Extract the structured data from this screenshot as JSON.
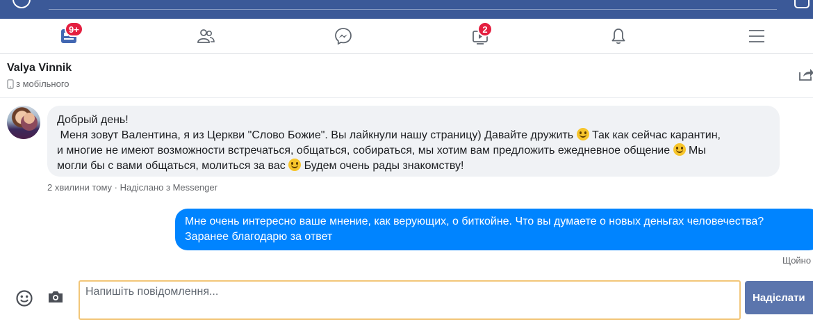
{
  "nav": {
    "items": [
      {
        "name": "news-feed",
        "badge": "9+"
      },
      {
        "name": "friends"
      },
      {
        "name": "messenger"
      },
      {
        "name": "watch",
        "badge": "2"
      },
      {
        "name": "notifications"
      },
      {
        "name": "menu"
      }
    ]
  },
  "conversation": {
    "contact_name": "Valya Vinnik",
    "contact_status": "з мобільного"
  },
  "messages": [
    {
      "direction": "incoming",
      "lines": [
        "Добрый день!",
        " Меня зовут Валентина, я из Церкви \"Слово Божие\". Вы лайкнули нашу страницу) Давайте дружить ",
        " Так как сейчас карантин,",
        "и многие не имеют возможности встречаться, общаться, собираться, мы хотим вам предложить ежедневное общение ",
        " Мы",
        "могли бы с вами общаться, молиться за вас ",
        " Будем очень рады знакомству!"
      ],
      "meta": "2 хвилини тому · Надіслано з Messenger"
    },
    {
      "direction": "outgoing",
      "lines": [
        "Мне очень интересно ваше мнение, как верующих, о биткойне. Что вы думаете о новых деньгах человечества?",
        "Заранее благодарю за ответ"
      ],
      "status": "Щойно"
    }
  ],
  "composer": {
    "placeholder": "Напишіть повідомлення...",
    "value": "",
    "send_label": "Надіслати"
  },
  "colors": {
    "topbar": "#3b5998",
    "outgoing_bubble": "#0084ff",
    "incoming_bubble": "#f0f2f5",
    "badge": "#e41e3f",
    "send_button": "#5b75ad",
    "input_border": "#f2c679"
  }
}
